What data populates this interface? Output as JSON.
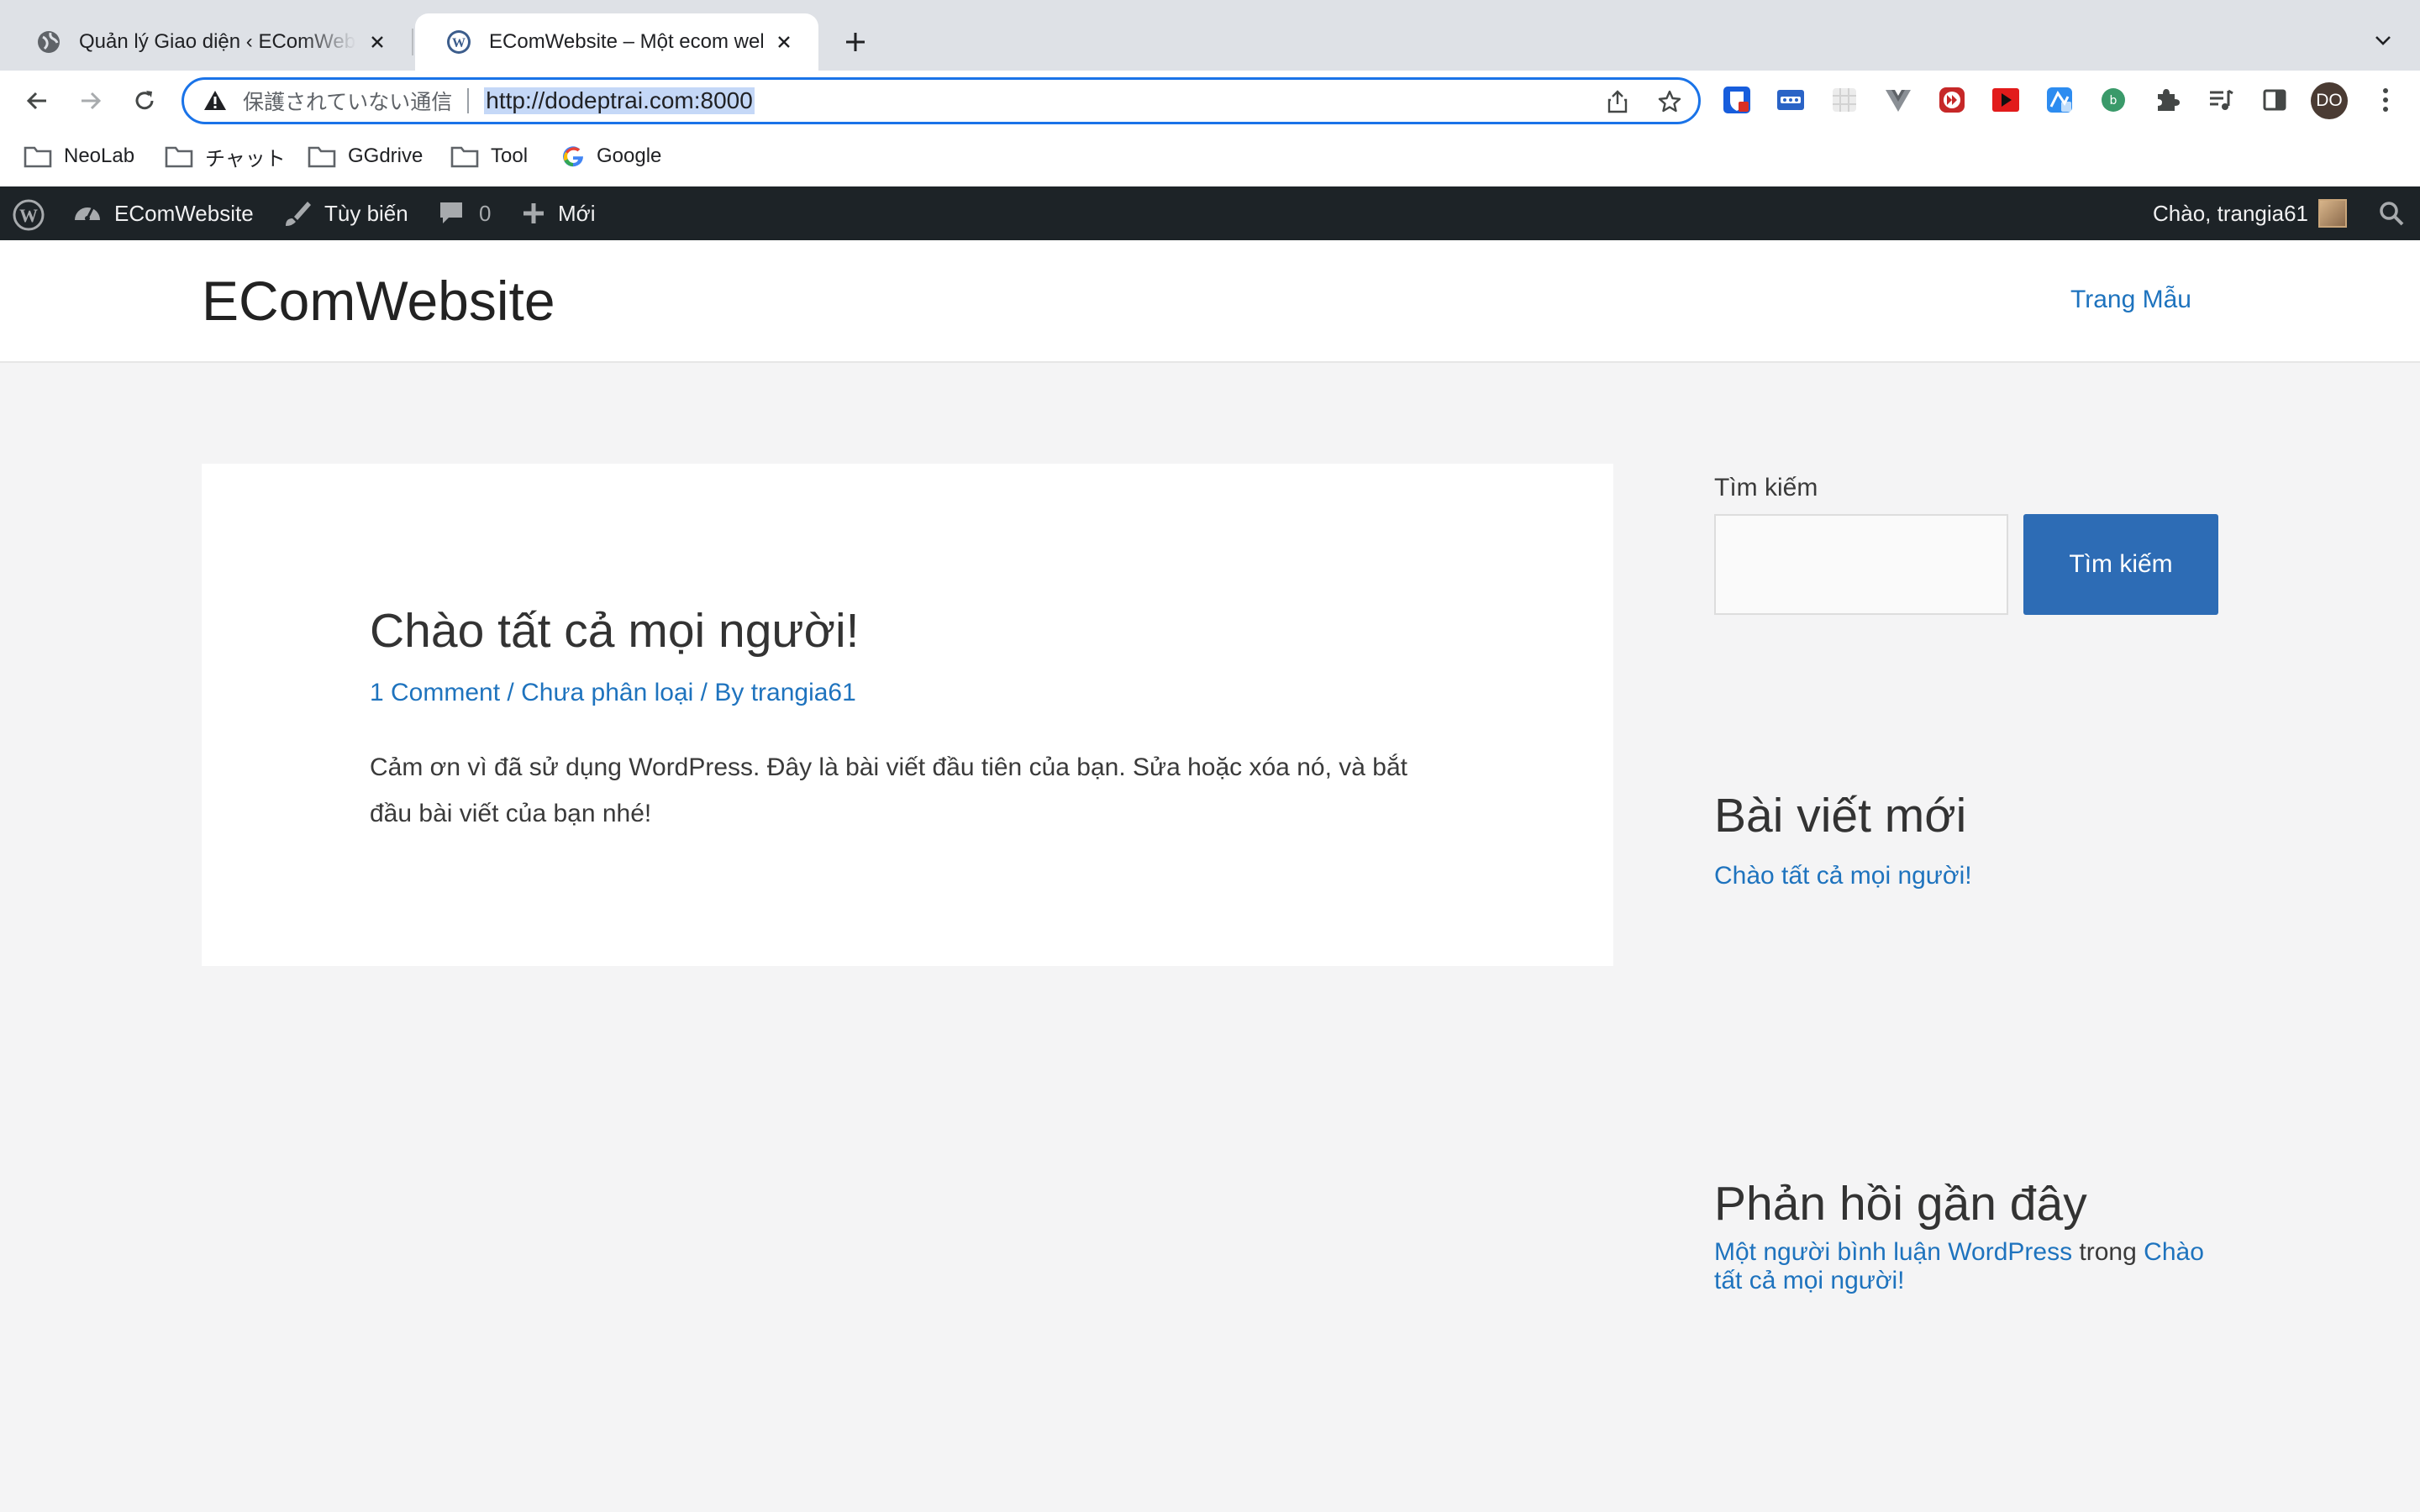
{
  "browser": {
    "tabs": [
      {
        "title": "Quản lý Giao diện ‹ EComWebsite",
        "favicon": "globe-icon",
        "active": false
      },
      {
        "title": "EComWebsite – Một ecom website",
        "favicon": "wordpress-icon",
        "active": true
      }
    ],
    "address_bar": {
      "security_text": "保護されていない通信",
      "url": "http://dodeptrai.com:8000"
    },
    "profile_initials": "DO",
    "extensions": [
      "bitwarden-icon",
      "tab-manager-icon",
      "grid-ext-icon",
      "vue-devtools-icon",
      "fast-forward-ext-icon",
      "youtube-icon",
      "translate-ext-icon",
      "green-circle-ext-icon",
      "puzzle-icon",
      "media-queue-icon",
      "side-panel-icon"
    ]
  },
  "bookmarks": [
    {
      "label": "NeoLab",
      "icon": "folder-icon"
    },
    {
      "label": "チャット",
      "icon": "folder-icon"
    },
    {
      "label": "GGdrive",
      "icon": "folder-icon"
    },
    {
      "label": "Tool",
      "icon": "folder-icon"
    },
    {
      "label": "Google",
      "icon": "google-icon"
    }
  ],
  "admin_bar": {
    "site_name": "EComWebsite",
    "customize": "Tùy biến",
    "comments_count": "0",
    "new_label": "Mới",
    "greeting": "Chào, trangia61"
  },
  "site": {
    "title": "EComWebsite",
    "nav": [
      "Trang Mẫu"
    ]
  },
  "post": {
    "title": "Chào tất cả mọi người!",
    "meta": {
      "comments": "1 Comment",
      "separator": "/",
      "category": "Chưa phân loại",
      "by_prefix": "/ By",
      "author": "trangia61"
    },
    "excerpt": "Cảm ơn vì đã sử dụng WordPress. Đây là bài viết đầu tiên của bạn. Sửa hoặc xóa nó, và bắt đầu bài viết của bạn nhé!"
  },
  "sidebar": {
    "search_label": "Tìm kiếm",
    "search_button": "Tìm kiếm",
    "recent_posts_heading": "Bài viết mới",
    "recent_posts": [
      "Chào tất cả mọi người!"
    ],
    "recent_comments_heading": "Phản hồi gần đây",
    "recent_comment": {
      "author": "Một người bình luận WordPress",
      "connector": "trong",
      "post": "Chào tất cả mọi người!"
    }
  },
  "colors": {
    "link": "#1e73be",
    "button": "#2d6cb5",
    "admin_bar": "#1d2327",
    "page_bg": "#f4f4f5",
    "omnibox_focus": "#1a73e8"
  }
}
